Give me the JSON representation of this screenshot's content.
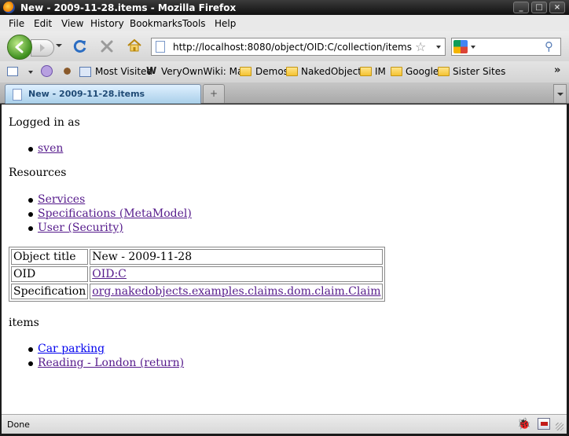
{
  "window": {
    "title": "New - 2009-11-28.items - Mozilla Firefox",
    "controls": {
      "minimize": "_",
      "maximize": "□",
      "close": "×"
    }
  },
  "menu": {
    "items": [
      "File",
      "Edit",
      "View",
      "History",
      "Bookmarks",
      "Tools",
      "Help"
    ]
  },
  "navbar": {
    "url": "http://localhost:8080/object/OID:C/collection/items",
    "search_engine": "google-icon"
  },
  "bookmarks": {
    "items": [
      {
        "label": "Most Visited",
        "icon": "bookmark-page-icon"
      },
      {
        "label": "VeryOwnWiki: Main",
        "icon": "wiki-icon"
      },
      {
        "label": "Demos",
        "icon": "folder-icon"
      },
      {
        "label": "NakedObjects",
        "icon": "folder-icon"
      },
      {
        "label": "IM",
        "icon": "folder-icon"
      },
      {
        "label": "Google",
        "icon": "folder-icon"
      },
      {
        "label": "Sister Sites",
        "icon": "folder-icon"
      }
    ],
    "overflow": "»"
  },
  "tabs": {
    "active": "New - 2009-11-28.items",
    "new_tab_symbol": "+"
  },
  "page": {
    "logged_in_heading": "Logged in as",
    "user": "sven",
    "resources_heading": "Resources",
    "resources": [
      "Services",
      "Specifications (MetaModel)",
      "User (Security)"
    ],
    "properties": {
      "rows": [
        {
          "label": "Object title",
          "value": "New - 2009-11-28",
          "link": false
        },
        {
          "label": "OID",
          "value": "OID:C",
          "link": true
        },
        {
          "label": "Specification",
          "value": "org.nakedobjects.examples.claims.dom.claim.Claim",
          "link": true
        }
      ]
    },
    "collection_heading": "items",
    "items": [
      "Car parking",
      "Reading - London (return)"
    ]
  },
  "status": {
    "text": "Done"
  },
  "colors": {
    "link_visited": "#551a8b",
    "link_unvisited": "#0000ee",
    "tab_active": "#a9cfe9"
  }
}
